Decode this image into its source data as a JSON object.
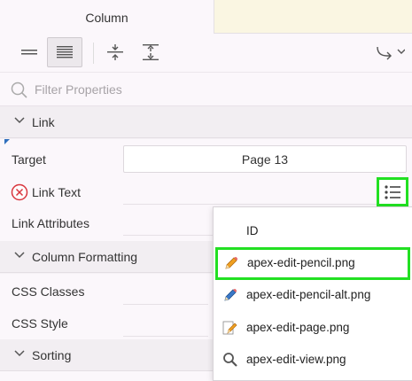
{
  "tabs": {
    "active_label": "Column"
  },
  "toolbar": {
    "buttons": [
      {
        "name": "show-common",
        "icon": "lines-short-icon"
      },
      {
        "name": "show-all",
        "icon": "lines-full-icon",
        "active": true
      },
      {
        "name": "collapse-all",
        "icon": "collapse-icon"
      },
      {
        "name": "expand-all",
        "icon": "expand-icon"
      },
      {
        "name": "go-to-group",
        "icon": "go-to-group-icon"
      }
    ]
  },
  "filter": {
    "placeholder": "Filter Properties"
  },
  "groups": {
    "link": "Link",
    "column_formatting": "Column Formatting",
    "sorting": "Sorting"
  },
  "properties": {
    "target": {
      "label": "Target",
      "value": "Page 13"
    },
    "link_text": {
      "label": "Link Text",
      "error_icon": "error-circle-icon"
    },
    "link_attributes": {
      "label": "Link Attributes"
    },
    "css_classes": {
      "label": "CSS Classes"
    },
    "css_style": {
      "label": "CSS Style"
    }
  },
  "menu": {
    "items": [
      {
        "label": "ID",
        "icon": ""
      },
      {
        "label": "apex-edit-pencil.png",
        "icon": "pencil-icon",
        "highlighted": true
      },
      {
        "label": "apex-edit-pencil-alt.png",
        "icon": "pencil-alt-icon"
      },
      {
        "label": "apex-edit-page.png",
        "icon": "pencil-page-icon"
      },
      {
        "label": "apex-edit-view.png",
        "icon": "magnifier-icon"
      }
    ]
  },
  "colors": {
    "highlight": "#22e022",
    "error": "#d9363e",
    "panel_bg": "#fbf7fb"
  }
}
